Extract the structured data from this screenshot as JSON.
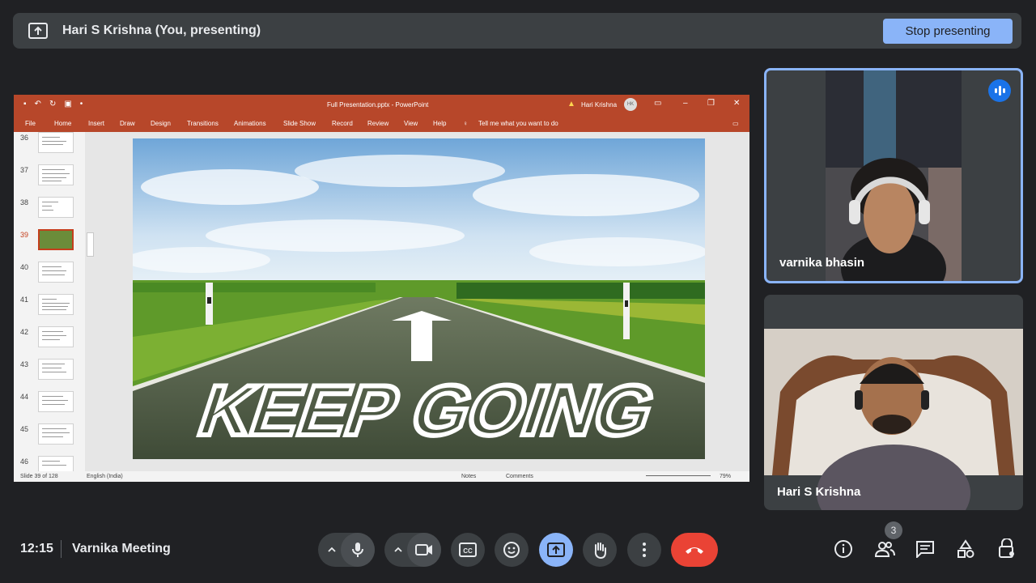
{
  "presenting_bar": {
    "title": "Hari S Krishna (You, presenting)",
    "stop_label": "Stop presenting"
  },
  "powerpoint": {
    "file_title": "Full Presentation.pptx  -  PowerPoint",
    "user_name": "Hari Krishna",
    "user_initials": "HK",
    "menu": [
      "File",
      "Home",
      "Insert",
      "Draw",
      "Design",
      "Transitions",
      "Animations",
      "Slide Show",
      "Record",
      "Review",
      "View",
      "Help"
    ],
    "tell_me": "Tell me what you want to do",
    "slide_numbers": [
      "36",
      "37",
      "38",
      "39",
      "40",
      "41",
      "42",
      "43",
      "44",
      "45",
      "46"
    ],
    "selected_slide": "39",
    "slide_text": "KEEP GOING",
    "status": {
      "slide_info": "Slide 39 of 128",
      "language": "English (India)",
      "notes": "Notes",
      "comments": "Comments",
      "zoom": "79%"
    }
  },
  "participants": [
    {
      "name": "varnika bhasin",
      "speaking": true
    },
    {
      "name": "Hari S Krishna",
      "speaking": false
    }
  ],
  "footer": {
    "time": "12:15",
    "meeting_name": "Varnika Meeting",
    "participant_count": "3"
  },
  "colors": {
    "background": "#202124",
    "tile": "#3c4043",
    "accent": "#8ab4f8",
    "end_call": "#ea4335",
    "ppt_red": "#b7472a"
  }
}
